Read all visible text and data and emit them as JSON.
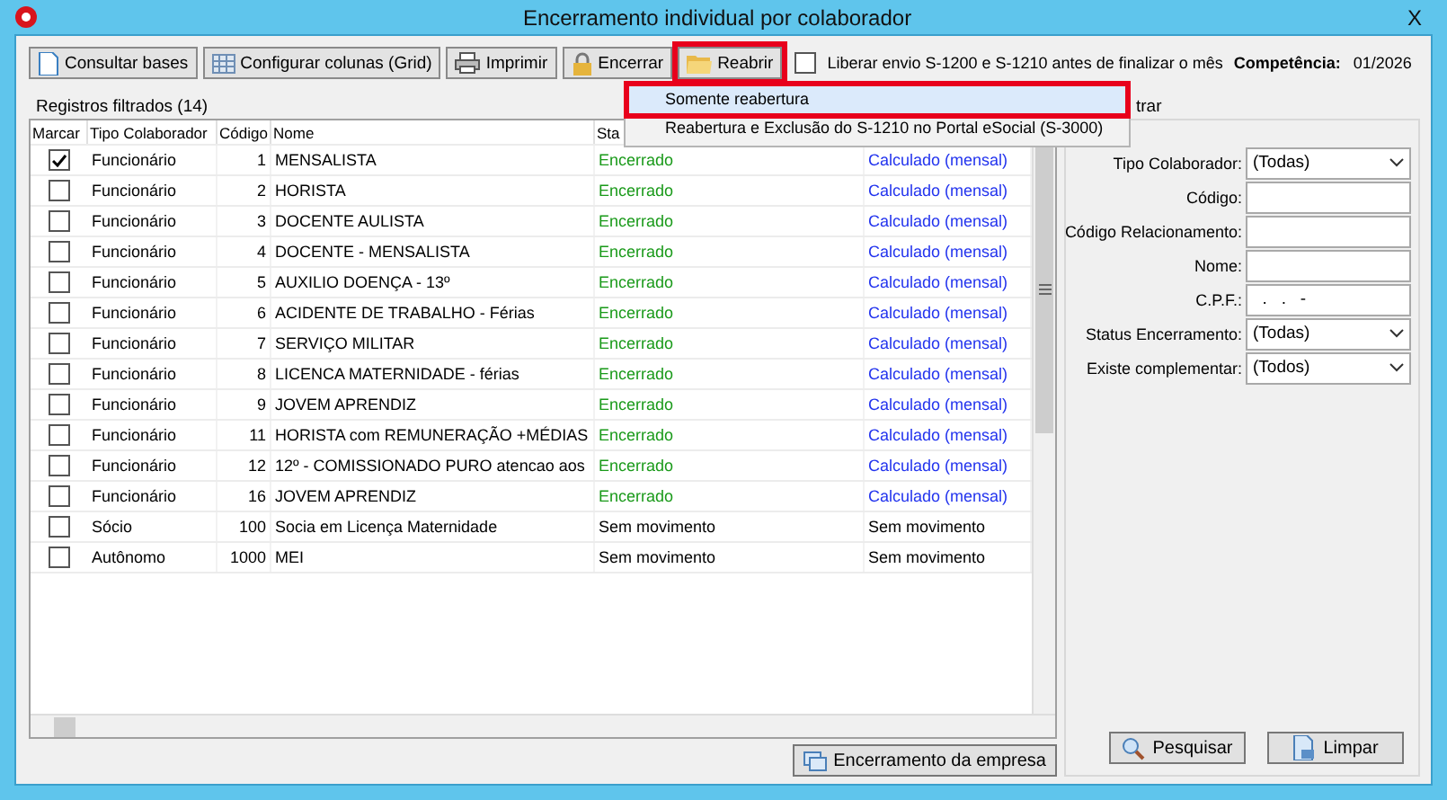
{
  "window": {
    "title": "Encerramento individual por colaborador",
    "close": "X"
  },
  "toolbar": {
    "buttons": [
      {
        "label": "Consultar bases",
        "highlighted": false
      },
      {
        "label": "Configurar colunas (Grid)",
        "highlighted": false
      },
      {
        "label": "Imprimir",
        "highlighted": false
      },
      {
        "label": "Encerrar",
        "highlighted": false
      },
      {
        "label": "Reabrir",
        "highlighted": true
      }
    ],
    "release": {
      "label": "Liberar envio S-1200 e S-1210 antes de finalizar o mês",
      "checked": false
    },
    "competencia": {
      "label": "Competência:",
      "value": "01/2026"
    }
  },
  "reopen_menu": {
    "items": [
      {
        "label": "Somente reabertura",
        "selected": true,
        "highlighted": true
      },
      {
        "label": "Reabertura e Exclusão do S-1210 no Portal eSocial (S-3000)",
        "selected": false,
        "highlighted": false
      }
    ]
  },
  "grid": {
    "title": "Registros filtrados (14)",
    "columns": [
      "Marcar",
      "Tipo Colaborador",
      "Código",
      "Nome",
      "Sta"
    ],
    "rows": [
      {
        "checked": true,
        "kind": "closed",
        "type": "Funcionário",
        "code": "1",
        "name": "MENSALISTA",
        "status": "Encerrado",
        "column_6": "Calculado (mensal)"
      },
      {
        "checked": false,
        "kind": "closed",
        "type": "Funcionário",
        "code": "2",
        "name": "HORISTA",
        "status": "Encerrado",
        "column_6": "Calculado (mensal)"
      },
      {
        "checked": false,
        "kind": "closed",
        "type": "Funcionário",
        "code": "3",
        "name": "DOCENTE AULISTA",
        "status": "Encerrado",
        "column_6": "Calculado (mensal)"
      },
      {
        "checked": false,
        "kind": "closed",
        "type": "Funcionário",
        "code": "4",
        "name": "DOCENTE -  MENSALISTA",
        "status": "Encerrado",
        "column_6": "Calculado (mensal)"
      },
      {
        "checked": false,
        "kind": "closed",
        "type": "Funcionário",
        "code": "5",
        "name": "AUXILIO DOENÇA - 13º",
        "status": "Encerrado",
        "column_6": "Calculado (mensal)"
      },
      {
        "checked": false,
        "kind": "closed",
        "type": "Funcionário",
        "code": "6",
        "name": "ACIDENTE DE TRABALHO - Férias",
        "status": "Encerrado",
        "column_6": "Calculado (mensal)"
      },
      {
        "checked": false,
        "kind": "closed",
        "type": "Funcionário",
        "code": "7",
        "name": "SERVIÇO MILITAR",
        "status": "Encerrado",
        "column_6": "Calculado (mensal)"
      },
      {
        "checked": false,
        "kind": "closed",
        "type": "Funcionário",
        "code": "8",
        "name": "LICENCA MATERNIDADE - férias",
        "status": "Encerrado",
        "column_6": "Calculado (mensal)"
      },
      {
        "checked": false,
        "kind": "closed",
        "type": "Funcionário",
        "code": "9",
        "name": "JOVEM APRENDIZ",
        "status": "Encerrado",
        "column_6": "Calculado (mensal)"
      },
      {
        "checked": false,
        "kind": "closed",
        "type": "Funcionário",
        "code": "11",
        "name": "HORISTA  com REMUNERAÇÃO +MÉDIAS",
        "status": "Encerrado",
        "column_6": "Calculado (mensal)"
      },
      {
        "checked": false,
        "kind": "closed",
        "type": "Funcionário",
        "code": "12",
        "name": "12º - COMISSIONADO PURO   atencao aos",
        "status": "Encerrado",
        "column_6": "Calculado (mensal)"
      },
      {
        "checked": false,
        "kind": "closed",
        "type": "Funcionário",
        "code": "16",
        "name": "JOVEM APRENDIZ",
        "status": "Encerrado",
        "column_6": "Calculado (mensal)"
      },
      {
        "checked": false,
        "kind": "none",
        "type": "Sócio",
        "code": "100",
        "name": "Socia em Licença Maternidade",
        "status": "Sem movimento",
        "column_6": "Sem movimento"
      },
      {
        "checked": false,
        "kind": "none",
        "type": "Autônomo",
        "code": "1000",
        "name": "MEI",
        "status": "Sem movimento",
        "column_6": "Sem movimento"
      }
    ]
  },
  "company_button": "Encerramento da empresa",
  "filter": {
    "title": "trar",
    "fields": [
      {
        "kind": "select",
        "label": "Tipo Colaborador:",
        "value": "(Todas)"
      },
      {
        "kind": "text",
        "label": "Código:"
      },
      {
        "kind": "text",
        "label": "Código Relacionamento:"
      },
      {
        "kind": "text",
        "label": "Nome:"
      },
      {
        "kind": "text",
        "label": "C.P.F.:",
        "value": "  .   .   -"
      },
      {
        "kind": "select",
        "label": "Status Encerramento:",
        "value": "(Todas)"
      },
      {
        "kind": "select",
        "label": "Existe complementar:",
        "value": "(Todos)"
      }
    ],
    "actions": [
      {
        "label": "Pesquisar"
      },
      {
        "label": "Limpar"
      }
    ]
  }
}
